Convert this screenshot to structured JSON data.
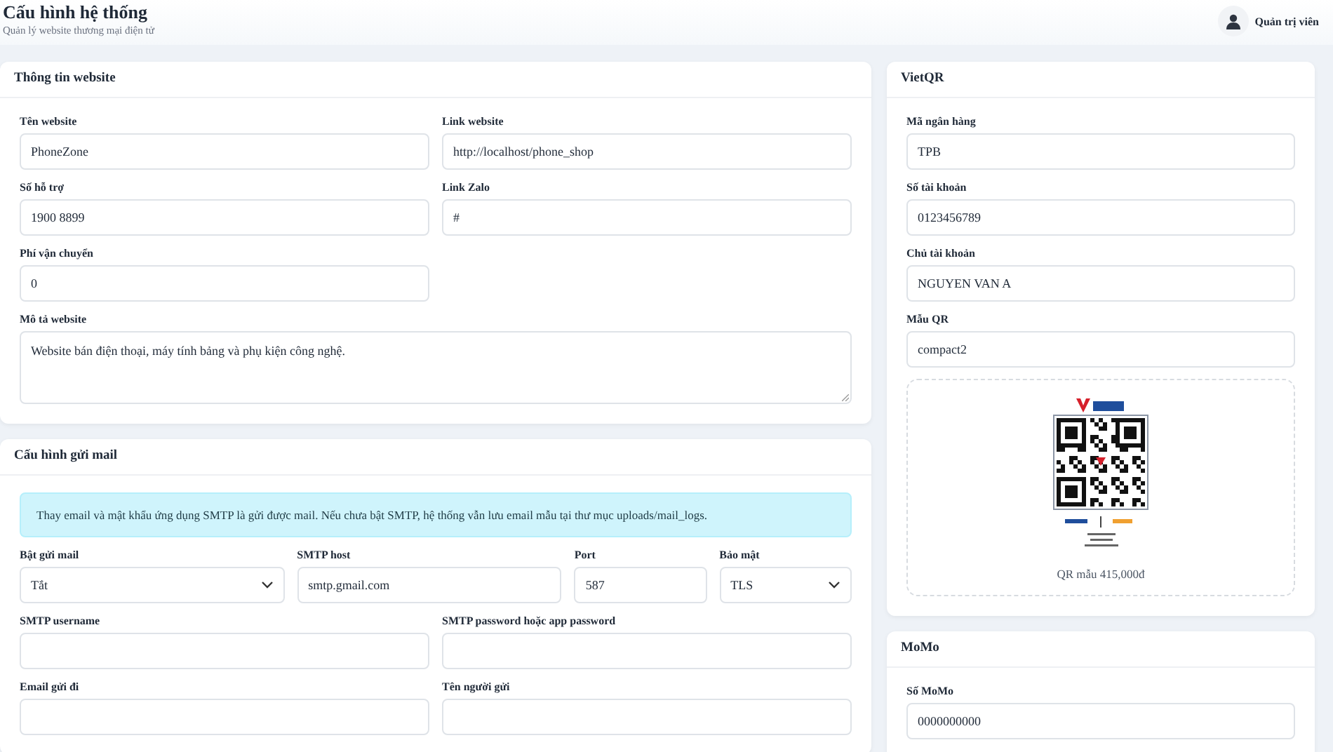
{
  "header": {
    "title": "Cấu hình hệ thống",
    "subtitle": "Quản lý website thương mại điện tử",
    "user": "Quản trị viên"
  },
  "website_card": {
    "title": "Thông tin website",
    "rows": [
      [
        {
          "label": "Tên website",
          "kind": "input",
          "value": "PhoneZone"
        },
        {
          "label": "Link website",
          "kind": "input",
          "value": "http://localhost/phone_shop"
        }
      ],
      [
        {
          "label": "Số hỗ trợ",
          "kind": "input",
          "value": "1900 8899"
        },
        {
          "label": "Link Zalo",
          "kind": "input",
          "value": "#"
        }
      ],
      [
        {
          "label": "Phí vận chuyển",
          "kind": "input",
          "value": "0"
        }
      ],
      [
        {
          "label": "Mô tả website",
          "kind": "textarea",
          "value": "Website bán điện thoại, máy tính bảng và phụ kiện công nghệ."
        }
      ]
    ]
  },
  "mail_card": {
    "title": "Cấu hình gửi mail",
    "alert": "Thay email và mật khẩu ứng dụng SMTP là gửi được mail. Nếu chưa bật SMTP, hệ thống vẫn lưu email mẫu tại thư mục uploads/mail_logs.",
    "rows": [
      [
        {
          "label": "Bật gửi mail",
          "kind": "select",
          "value": "Tắt"
        },
        {
          "label": "SMTP host",
          "kind": "input",
          "value": "smtp.gmail.com"
        },
        {
          "label": "Port",
          "kind": "input",
          "value": "587"
        },
        {
          "label": "Bảo mật",
          "kind": "select",
          "value": "TLS"
        }
      ],
      [
        {
          "label": "SMTP username",
          "kind": "input"
        },
        {
          "label": "SMTP password hoặc app password",
          "kind": "input"
        }
      ],
      [
        {
          "label": "Email gửi đi",
          "kind": "input"
        },
        {
          "label": "Tên người gửi",
          "kind": "input"
        }
      ]
    ]
  },
  "vietqr_card": {
    "title": "VietQR",
    "fields": [
      {
        "label": "Mã ngân hàng",
        "value": "TPB"
      },
      {
        "label": "Số tài khoản",
        "value": "0123456789"
      },
      {
        "label": "Chủ tài khoản",
        "value": "NGUYEN VAN A"
      },
      {
        "label": "Mẫu QR",
        "value": "compact2"
      }
    ],
    "qr_caption": "QR mẫu 415,000đ"
  },
  "momo_card": {
    "title": "MoMo",
    "fields": [
      {
        "label": "Số MoMo",
        "value": "0000000000"
      }
    ]
  }
}
